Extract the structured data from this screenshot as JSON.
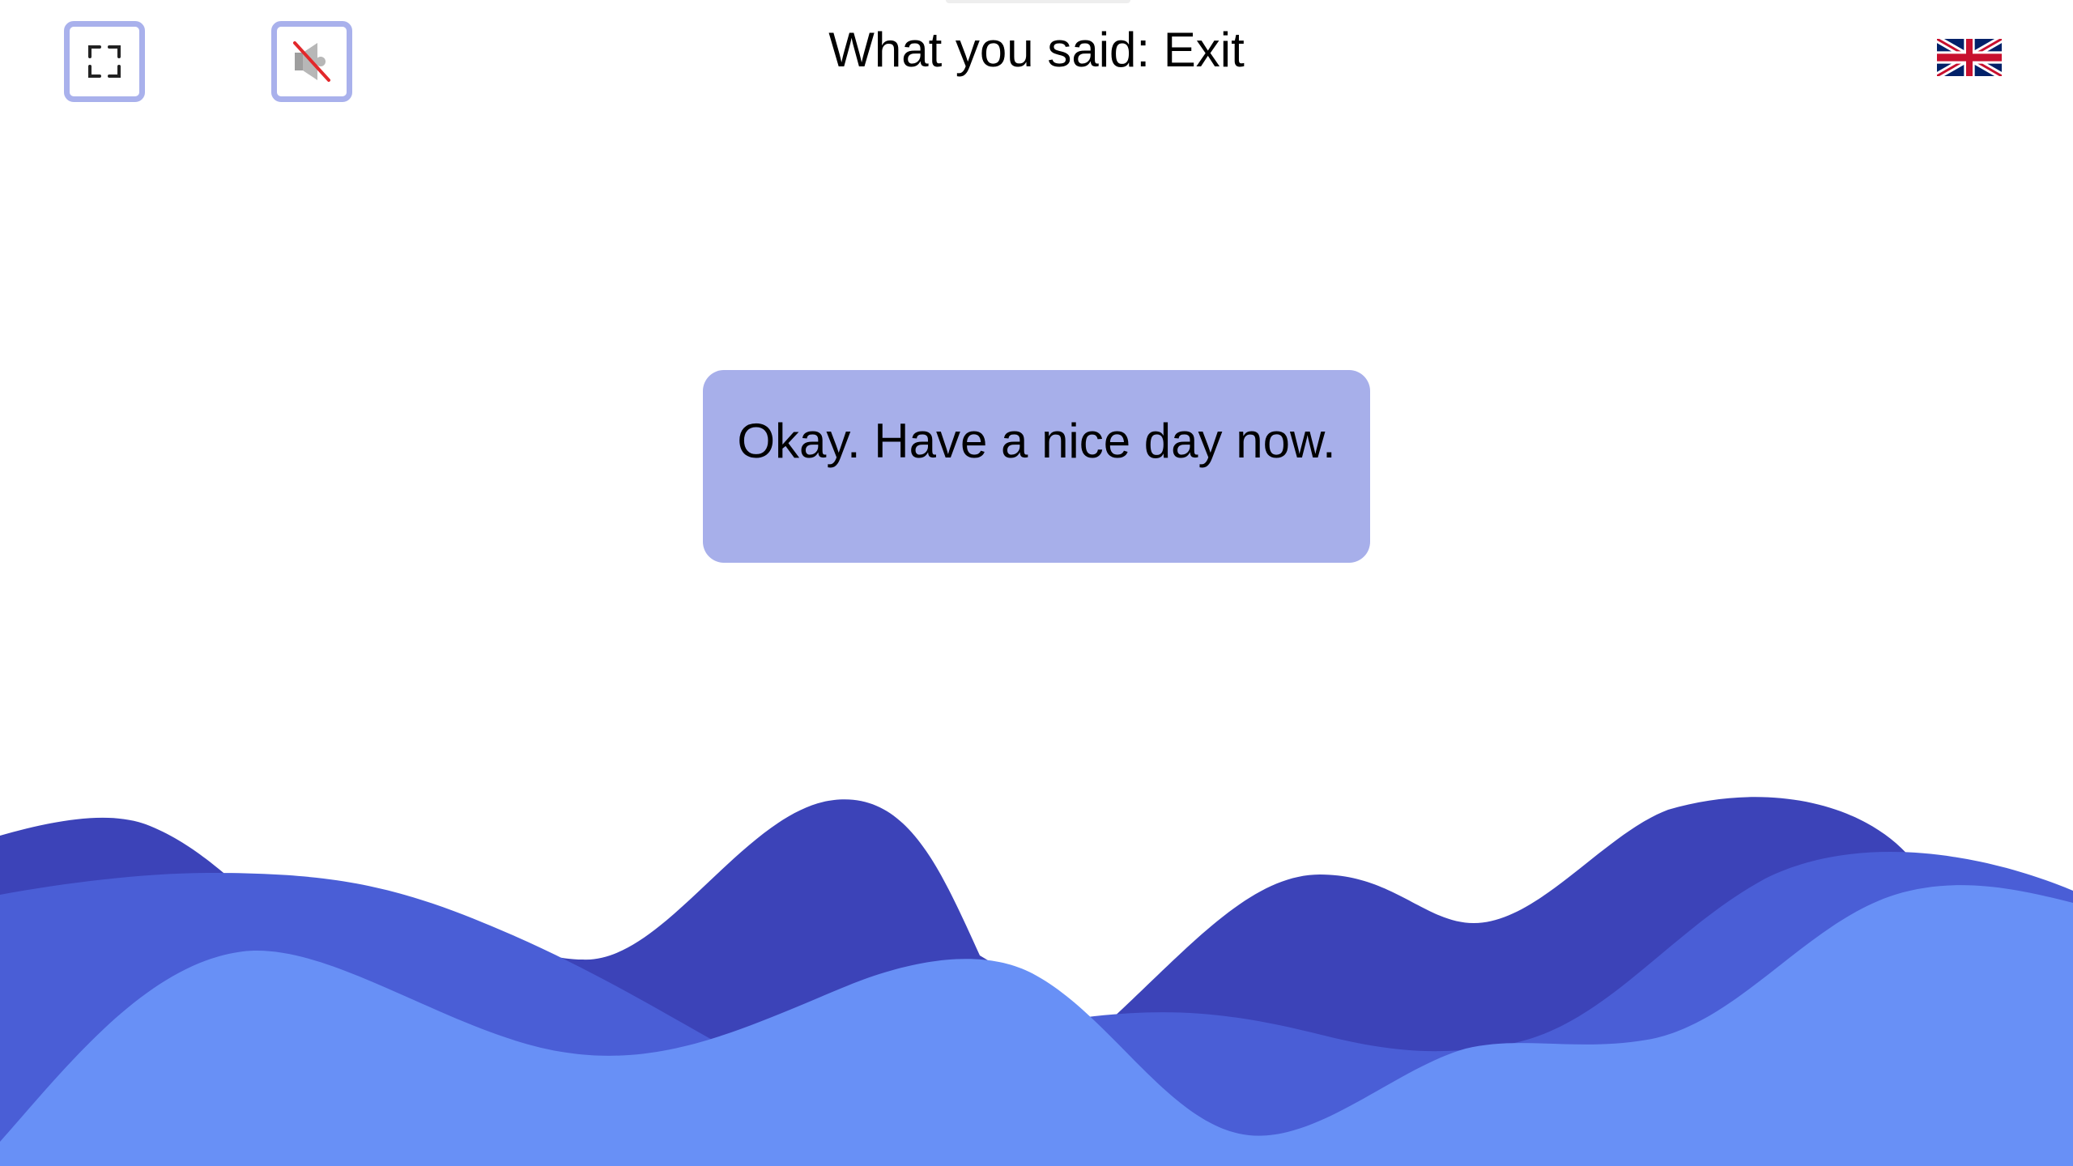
{
  "header": {
    "said_prefix": "What you said:",
    "said_value": "Exit",
    "said_text": "What you said: Exit"
  },
  "controls": {
    "fullscreen_icon": "fullscreen-icon",
    "sound_icon": "sound-muted-icon",
    "language_icon": "uk-flag-icon"
  },
  "bubble": {
    "text": "Okay. Have a nice day now."
  },
  "colors": {
    "button_border": "#a9b1ec",
    "bubble_bg": "#a7afea",
    "wave_dark": "#3c43b8",
    "wave_mid": "#4a5ed6",
    "wave_light": "#6890f6"
  }
}
